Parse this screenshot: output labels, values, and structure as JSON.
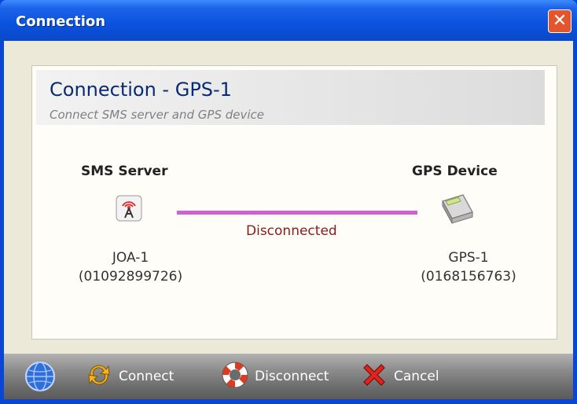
{
  "window": {
    "title": "Connection",
    "close_glyph": "✕"
  },
  "header": {
    "title": "Connection - GPS-1",
    "subtitle": "Connect SMS server and GPS device"
  },
  "left_node": {
    "title": "SMS Server",
    "icon": "antenna-icon",
    "name": "JOA-1",
    "number": "(01092899726)"
  },
  "right_node": {
    "title": "GPS Device",
    "icon": "gps-device-icon",
    "name": "GPS-1",
    "number": "(0168156763)"
  },
  "link": {
    "status": "Disconnected",
    "line_color": "#d360d3",
    "status_color": "#8b1a1a"
  },
  "toolbar": {
    "app_icon": "globe-icon",
    "connect_label": "Connect",
    "disconnect_label": "Disconnect",
    "cancel_label": "Cancel"
  }
}
